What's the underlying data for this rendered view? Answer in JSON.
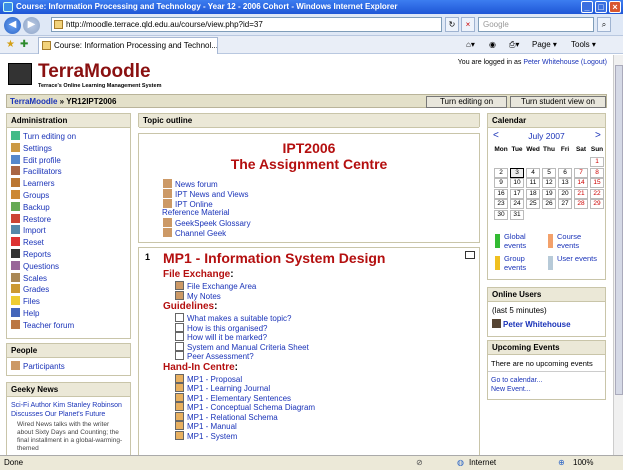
{
  "window": {
    "title": "Course: Information Processing and Technology - Year 12 - 2006 Cohort - Windows Internet Explorer",
    "url": "http://moodle.terrace.qld.edu.au/course/view.php?id=37",
    "search_placeholder": "Google",
    "tab_title": "Course: Information Processing and Technol...",
    "tools": {
      "page": "Page",
      "tools": "Tools"
    }
  },
  "header": {
    "logo_title": "TerraMoodle",
    "logo_subtitle": "Terrace's Online Learning Management System",
    "login_prefix": "You are logged in as",
    "login_user": "Peter Whitehouse",
    "logout": "(Logout)"
  },
  "navbar": {
    "home": "TerraMoodle",
    "separator": "»",
    "course": "YR12IPT2006",
    "btn_editing": "Turn editing on",
    "btn_student": "Turn student view on"
  },
  "admin": {
    "title": "Administration",
    "items": [
      "Turn editing on",
      "Settings",
      "Edit profile",
      "Facilitators",
      "Learners",
      "Groups",
      "Backup",
      "Restore",
      "Import",
      "Reset",
      "Reports",
      "Questions",
      "Scales",
      "Grades",
      "Files",
      "Help",
      "Teacher forum"
    ]
  },
  "people": {
    "title": "People",
    "items": [
      "Participants"
    ]
  },
  "geeky": {
    "title": "Geeky News",
    "headline": "Sci-Fi Author Kim Stanley Robinson Discusses Our Planet's Future",
    "snippet": "Wired News talks with the writer about Sixty Days and Counting; the final installment in a global-warming-themed"
  },
  "outline": {
    "title": "Topic outline",
    "heading1": "IPT2006",
    "heading2": "The Assignment Centre",
    "links": [
      "News forum",
      "IPT News and Views",
      "IPT Online",
      "Reference Material",
      "GeekSpeek Glossary",
      "Channel Geek"
    ]
  },
  "topic1": {
    "number": "1",
    "title": "MP1 - Information System Design",
    "sections": [
      {
        "label": "File Exchange",
        "colon": ":",
        "items": [
          "File Exchange Area",
          "My Notes"
        ]
      },
      {
        "label": "Guidelines",
        "colon": ":",
        "items": [
          "What makes a suitable topic?",
          "How is this organised?",
          "How will it be marked?",
          "System and Manual Criteria Sheet",
          "Peer Assessment?"
        ]
      },
      {
        "label": "Hand-In Centre",
        "colon": ":",
        "items": [
          "MP1 - Proposal",
          "MP1 - Learning Journal",
          "MP1 - Elementary Sentences",
          "MP1 - Conceptual Schema Diagram",
          "MP1 - Relational Schema",
          "MP1 - Manual",
          "MP1 - System"
        ]
      }
    ]
  },
  "calendar": {
    "title": "Calendar",
    "month": "July 2007",
    "prev": "<",
    "next": ">",
    "days": [
      "Mon",
      "Tue",
      "Wed",
      "Thu",
      "Fri",
      "Sat",
      "Sun"
    ],
    "weeks": [
      [
        "",
        "",
        "",
        "",
        "",
        "",
        "1"
      ],
      [
        "2",
        "3",
        "4",
        "5",
        "6",
        "7",
        "8"
      ],
      [
        "9",
        "10",
        "11",
        "12",
        "13",
        "14",
        "15"
      ],
      [
        "16",
        "17",
        "18",
        "19",
        "20",
        "21",
        "22"
      ],
      [
        "23",
        "24",
        "25",
        "26",
        "27",
        "28",
        "29"
      ],
      [
        "30",
        "31",
        "",
        "",
        "",
        "",
        ""
      ]
    ],
    "today": "3",
    "legend": [
      "Global events",
      "Course events",
      "Group events",
      "User events"
    ],
    "legend_colors": [
      "#33bb33",
      "#f3a16b",
      "#f0c020",
      "#b7cad8"
    ]
  },
  "online": {
    "title": "Online Users",
    "note": "(last 5 minutes)",
    "user": "Peter Whitehouse"
  },
  "upcoming": {
    "title": "Upcoming Events",
    "none": "There are no upcoming events",
    "goto": "Go to calendar...",
    "new": "New Event..."
  },
  "status": {
    "text": "Done",
    "zone": "Internet",
    "zoom": "100%"
  }
}
